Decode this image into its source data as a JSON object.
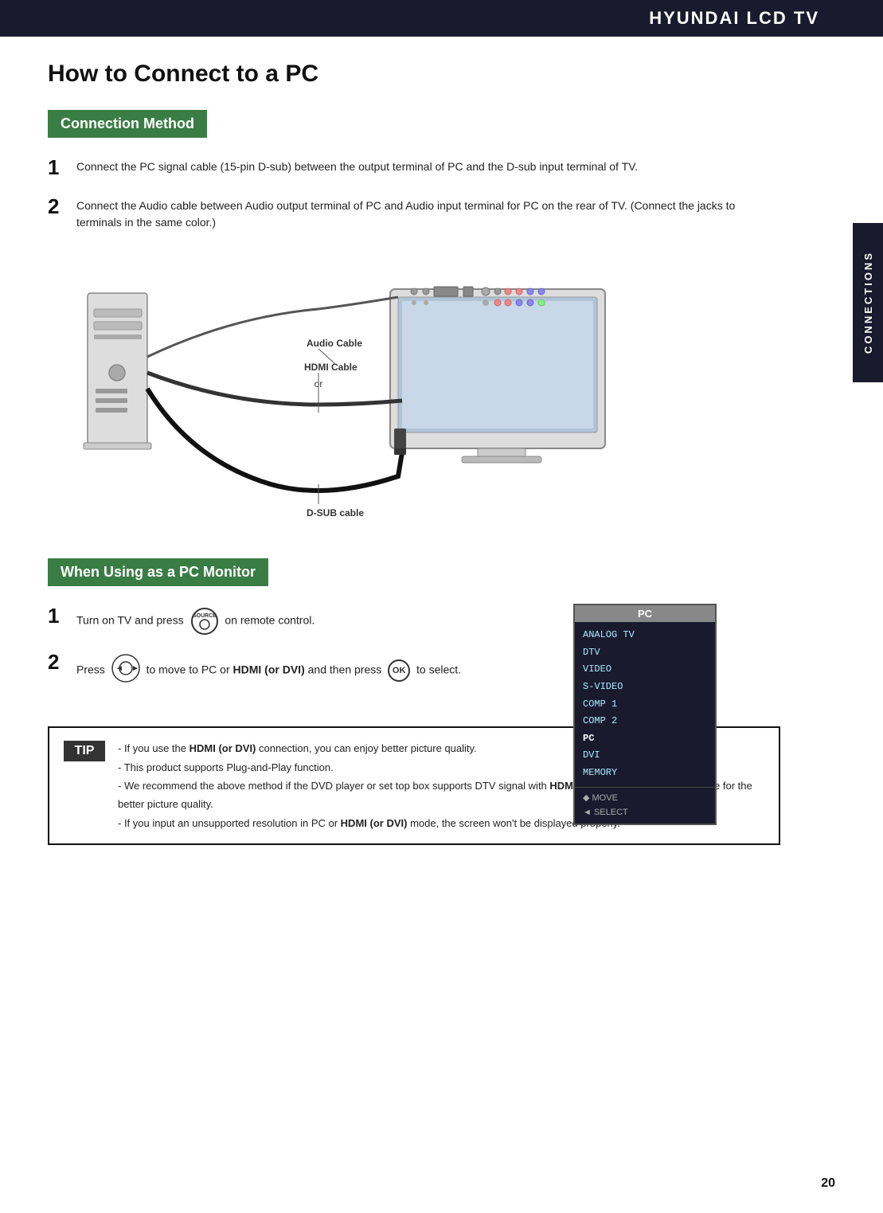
{
  "header": {
    "title": "HYUNDAI LCD TV"
  },
  "side_tab": {
    "label": "CONNECTIONS"
  },
  "page_title": "How to Connect to a PC",
  "section1": {
    "header": "Connection Method",
    "steps": [
      {
        "num": "1",
        "text": "Connect the PC signal cable (15-pin D-sub) between the output terminal of PC and the D-sub input terminal of TV."
      },
      {
        "num": "2",
        "text": "Connect the Audio cable between Audio output terminal of PC and Audio input terminal for PC on the rear of TV. (Connect the jacks to terminals in the same color.)"
      }
    ],
    "cable_labels": {
      "audio": "Audio Cable",
      "hdmi": "HDMI Cable",
      "or": "or",
      "dsub": "D-SUB cable"
    }
  },
  "section2": {
    "header": "When Using as a PC Monitor",
    "steps": [
      {
        "num": "1",
        "text_before": "Turn on TV and press",
        "source_label": "SOURCE",
        "text_after": "on remote control."
      },
      {
        "num": "2",
        "text_before": "Press",
        "nav_icon": "◄◉►",
        "text_middle": "to move to PC or",
        "bold_middle": "HDMI (or DVI)",
        "text_middle2": "and then press",
        "ok_label": "OK",
        "text_after": "to select."
      }
    ],
    "pc_menu": {
      "header": "PC",
      "items": [
        "ANALOG TV",
        "DTV",
        "VIDEO",
        "S-VIDEO",
        "COMP 1",
        "COMP 2",
        "PC",
        "DVI",
        "MEMORY"
      ],
      "footer": [
        "◆ MOVE",
        "◄ SELECT"
      ]
    }
  },
  "tip": {
    "label": "TIP",
    "lines": [
      "- If you use the **HDMI (or DVI)** connection, you can enjoy better picture quality.",
      "- This product supports Plug-and-Play function.",
      "- We recommend the above method if the DVD player or set top box supports DTV signal with **HDMI (or DVI)**/ D-Sub (15 pin) cable for the better picture quality.",
      "- If you input an unsupported resolution in PC or **HDMI (or DVI)** mode, the screen won't be displayed properly."
    ],
    "lines_raw": [
      {
        "text": "- If you use the ",
        "bold": "HDMI (or DVI)",
        "text2": " connection, you can enjoy better picture quality."
      },
      {
        "text": "- This product supports Plug-and-Play function.",
        "bold": "",
        "text2": ""
      },
      {
        "text": "- We recommend the above method if the DVD player or set top box supports DTV signal with ",
        "bold": "HDMI (or DVI)",
        "text2": "/ D-Sub (15 pin) cable for the better picture quality."
      },
      {
        "text": "- If you input an unsupported resolution in PC or ",
        "bold": "HDMI (or DVI)",
        "text2": " mode, the screen won't be displayed properly."
      }
    ]
  },
  "page_number": "20"
}
